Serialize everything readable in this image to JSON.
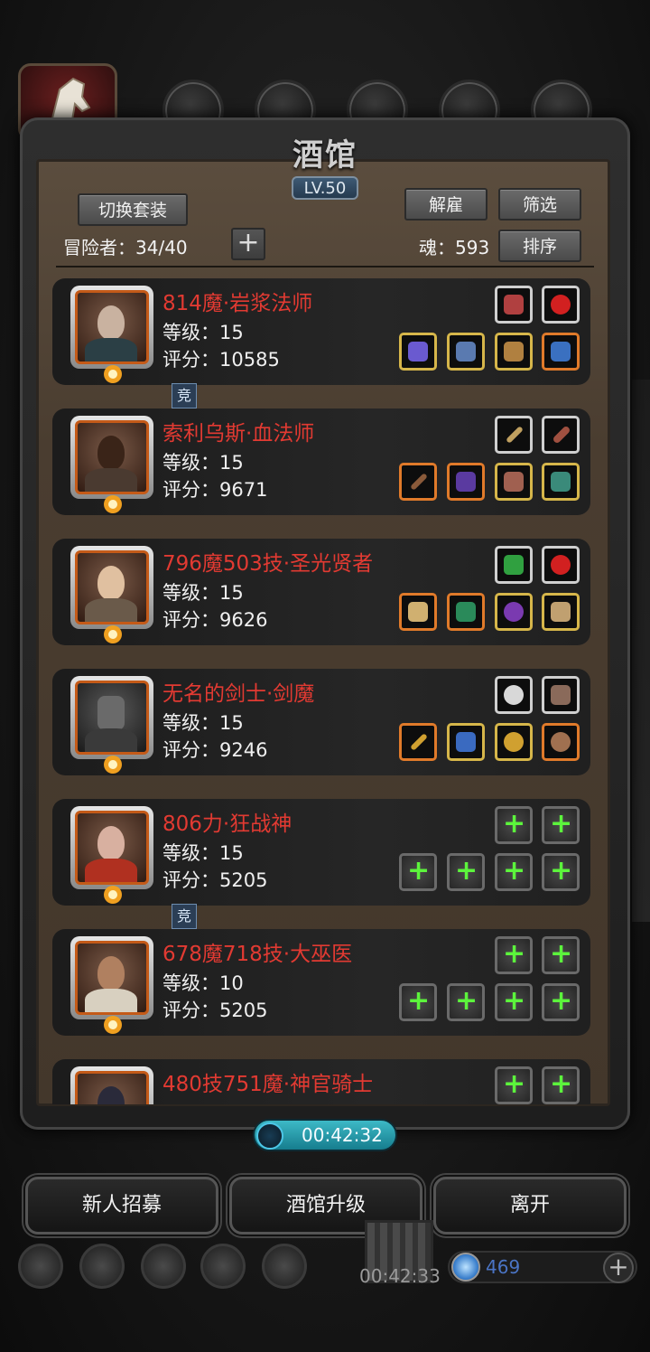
{
  "header": {
    "title": "酒馆",
    "level": "LV.50"
  },
  "toolbar": {
    "switch_set": "切换套装",
    "dismiss": "解雇",
    "filter": "筛选",
    "sort": "排序",
    "adventurers_label": "冒险者：",
    "adventurers_value": "34/40",
    "soul_label": "魂：",
    "soul_value": "593"
  },
  "common": {
    "level_prefix": "等级：",
    "score_prefix": "评分：",
    "tag": "竞"
  },
  "heroes": [
    {
      "name": "814魔·岩浆法师",
      "level": "15",
      "score": "10585"
    },
    {
      "name": "索利乌斯·血法师",
      "level": "15",
      "score": "9671"
    },
    {
      "name": "796魔503技·圣光贤者",
      "level": "15",
      "score": "9626"
    },
    {
      "name": "无名的剑士·剑魔",
      "level": "15",
      "score": "9246"
    },
    {
      "name": "806力·狂战神",
      "level": "15",
      "score": "5205"
    },
    {
      "name": "678魔718技·大巫医",
      "level": "10",
      "score": "5205"
    },
    {
      "name": "480技751魔·神官骑士",
      "level": "",
      "score": ""
    }
  ],
  "timer": {
    "value": "00:42:32"
  },
  "bottom": {
    "recruit": "新人招募",
    "upgrade": "酒馆升级",
    "leave": "离开"
  },
  "background": {
    "timer2": "00:42:33",
    "gems": "469"
  },
  "icons": [
    "horse-emblem-icon",
    "clock-icon",
    "gem-icon",
    "plus-icon",
    "gear-icon",
    "star-icon",
    "scroll-icon",
    "mail-icon",
    "shield-icon"
  ]
}
